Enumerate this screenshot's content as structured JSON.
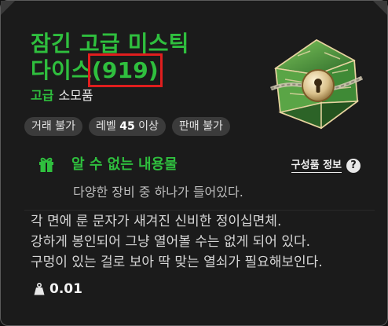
{
  "item": {
    "name_line1": "잠긴 고급 미스틱",
    "name_line2_prefix": "다이스",
    "name_line2_count": "(919)",
    "grade": "고급",
    "category": "소모품"
  },
  "tags": {
    "trade": "거래 불가",
    "level_prefix": "레벨",
    "level_value": "45",
    "level_suffix": "이상",
    "sell": "판매 불가"
  },
  "contents": {
    "title": "알 수 없는 내용물",
    "desc": "다양한 장비 중 하나가 들어있다.",
    "link_label": "구성품 정보",
    "help_symbol": "?"
  },
  "description": [
    "각 면에 룬 문자가 새겨진 신비한 정이십면체.",
    "강하게 봉인되어 그냥 열어볼 수는 없게 되어 있다.",
    "구멍이 있는 걸로 보아 딱 맞는 열쇠가 필요해보인다."
  ],
  "weight": "0.01",
  "icons": {
    "item": "green-d20-dice-icon",
    "contents": "gift-icon",
    "help": "question-circle-icon",
    "weight": "weight-icon"
  },
  "colors": {
    "accent": "#2fbf3e",
    "highlight_box": "#e01e1e",
    "background": "#1b1b1b",
    "tag_bg": "#3b3b3b"
  }
}
